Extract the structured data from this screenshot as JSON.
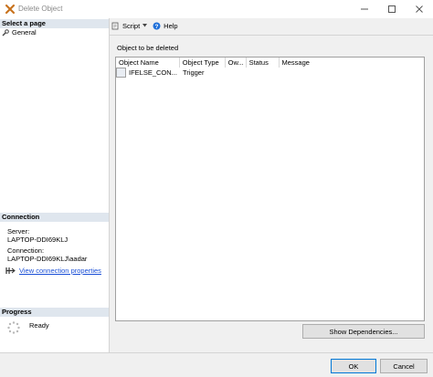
{
  "window": {
    "title": "Delete Object"
  },
  "left_pane": {
    "select_page_header": "Select a page",
    "pages": [
      {
        "label": "General"
      }
    ],
    "connection_header": "Connection",
    "server_label": "Server:",
    "server_value": "LAPTOP-DDI69KLJ",
    "connection_label": "Connection:",
    "connection_value": "LAPTOP-DDI69KLJ\\aadar",
    "view_connection_link": "View connection properties",
    "progress_header": "Progress",
    "progress_status": "Ready"
  },
  "toolbar": {
    "script_label": "Script",
    "help_label": "Help"
  },
  "main": {
    "section_label": "Object to be deleted",
    "columns": [
      "Object Name",
      "Object Type",
      "Ow...",
      "Status",
      "Message"
    ],
    "rows": [
      {
        "name": "IFELSE_CON...",
        "type": "Trigger",
        "owner": "",
        "status": "",
        "message": ""
      }
    ],
    "show_dependencies": "Show Dependencies..."
  },
  "footer": {
    "ok": "OK",
    "cancel": "Cancel"
  },
  "colors": {
    "section_header_bg": "#dfe6ee",
    "link": "#1a4fd6",
    "accent_border": "#0078d7"
  }
}
